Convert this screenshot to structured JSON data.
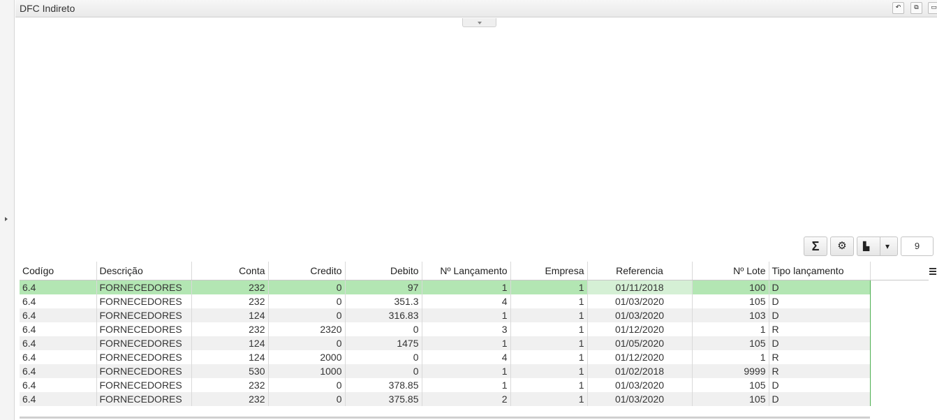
{
  "window": {
    "title": "DFC Indireto",
    "buttons": [
      {
        "name": "restore-window-button",
        "glyph": "↶"
      },
      {
        "name": "float-window-button",
        "glyph": "⧉"
      },
      {
        "name": "maximize-window-button",
        "glyph": "▭"
      }
    ]
  },
  "toolbar": {
    "sum_glyph": "Σ",
    "settings_glyph": "⚙",
    "export_glyph": "▙",
    "dropdown_glyph": "▾",
    "page_size": "9"
  },
  "grid": {
    "columns": [
      "Codígo",
      "Descrição",
      "Conta",
      "Credito",
      "Debito",
      "Nº Lançamento",
      "Empresa",
      "Referencia",
      "Nº Lote",
      "Tipo lançamento"
    ],
    "rows": [
      [
        "6.4",
        "FORNECEDORES",
        "232",
        "0",
        "97",
        "1",
        "1",
        "01/11/2018",
        "100",
        "D"
      ],
      [
        "6.4",
        "FORNECEDORES",
        "232",
        "0",
        "351.3",
        "4",
        "1",
        "01/03/2020",
        "105",
        "D"
      ],
      [
        "6.4",
        "FORNECEDORES",
        "124",
        "0",
        "316.83",
        "1",
        "1",
        "01/03/2020",
        "103",
        "D"
      ],
      [
        "6.4",
        "FORNECEDORES",
        "232",
        "2320",
        "0",
        "3",
        "1",
        "01/12/2020",
        "1",
        "R"
      ],
      [
        "6.4",
        "FORNECEDORES",
        "124",
        "0",
        "1475",
        "1",
        "1",
        "01/05/2020",
        "105",
        "D"
      ],
      [
        "6.4",
        "FORNECEDORES",
        "124",
        "2000",
        "0",
        "4",
        "1",
        "01/12/2020",
        "1",
        "R"
      ],
      [
        "6.4",
        "FORNECEDORES",
        "530",
        "1000",
        "0",
        "1",
        "1",
        "01/02/2018",
        "9999",
        "R"
      ],
      [
        "6.4",
        "FORNECEDORES",
        "232",
        "0",
        "378.85",
        "1",
        "1",
        "01/03/2020",
        "105",
        "D"
      ],
      [
        "6.4",
        "FORNECEDORES",
        "232",
        "0",
        "375.85",
        "2",
        "1",
        "01/03/2020",
        "105",
        "D"
      ]
    ],
    "selected_row": 0
  },
  "colors": {
    "selected_row": "#b3e6b3",
    "accent_border": "#4caf50"
  }
}
